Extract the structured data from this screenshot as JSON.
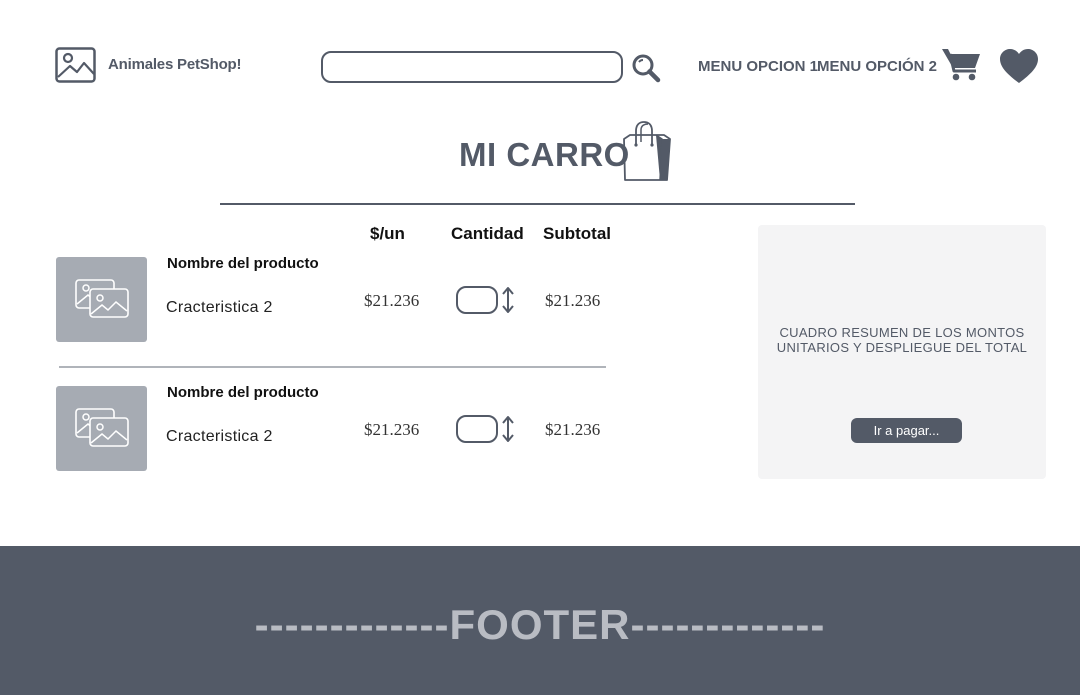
{
  "header": {
    "brand": "Animales PetShop!",
    "search_placeholder": "",
    "menu": [
      "MENU OPCION 1",
      "MENU OPCIÓN 2"
    ],
    "icons": [
      "image-logo-icon",
      "search-icon",
      "cart-icon",
      "heart-icon"
    ]
  },
  "page": {
    "title": "MI CARRO",
    "title_icon": "shopping-bag-icon"
  },
  "cart": {
    "columns": [
      "$/un",
      "Cantidad",
      "Subtotal"
    ],
    "items": [
      {
        "name": "Nombre del producto",
        "attribute": "Cracteristica 2",
        "unit_price": "$21.236",
        "quantity": "",
        "subtotal": "$21.236"
      },
      {
        "name": "Nombre del producto",
        "attribute": "Cracteristica 2",
        "unit_price": "$21.236",
        "quantity": "",
        "subtotal": "$21.236"
      }
    ]
  },
  "summary": {
    "text_line1": "CUADRO RESUMEN DE LOS MONTOS",
    "text_line2": "UNITARIOS Y DESPLIEGUE DEL TOTAL",
    "pay_button": "Ir a pagar..."
  },
  "footer": {
    "text": "-------------FOOTER-------------"
  },
  "colors": {
    "primary": "#535a67",
    "thumb": "#a6abb3",
    "summary_bg": "#f4f4f5",
    "footer_text": "#b9bcc3"
  }
}
